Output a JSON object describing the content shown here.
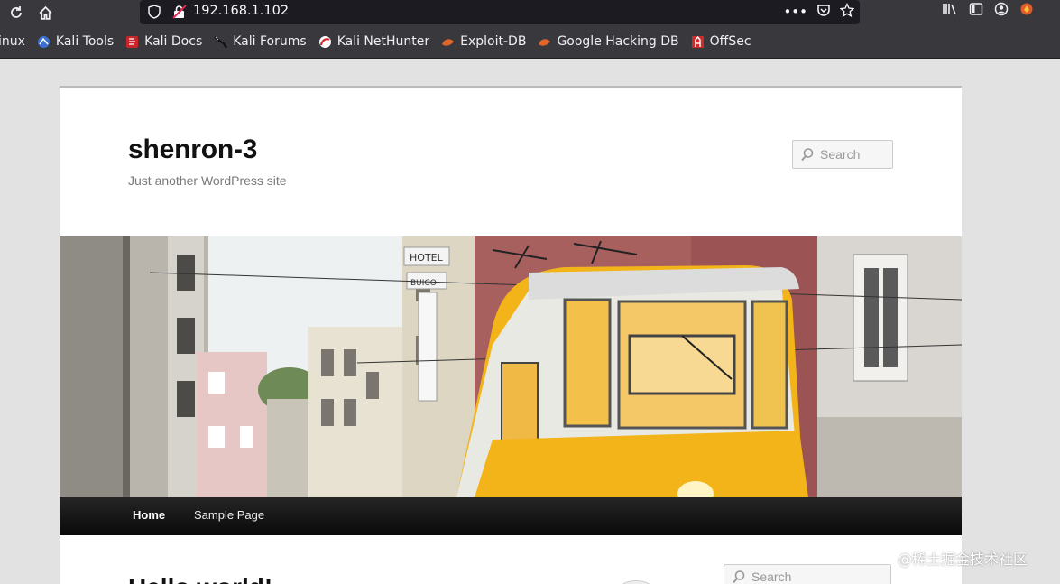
{
  "browser": {
    "url": "192.168.1.102",
    "bookmarks": [
      {
        "label": "inux",
        "icon": "none"
      },
      {
        "label": "Kali Tools",
        "icon": "kali-tools-icon"
      },
      {
        "label": "Kali Docs",
        "icon": "kali-docs-icon"
      },
      {
        "label": "Kali Forums",
        "icon": "kali-forums-icon"
      },
      {
        "label": "Kali NetHunter",
        "icon": "kali-nethunter-icon"
      },
      {
        "label": "Exploit-DB",
        "icon": "exploit-db-icon"
      },
      {
        "label": "Google Hacking DB",
        "icon": "ghdb-icon"
      },
      {
        "label": "OffSec",
        "icon": "offsec-icon"
      }
    ]
  },
  "site": {
    "title": "shenron-3",
    "description": "Just another WordPress site",
    "search_placeholder": "Search"
  },
  "nav": {
    "items": [
      {
        "label": "Home"
      },
      {
        "label": "Sample Page"
      }
    ]
  },
  "sidebar": {
    "search_placeholder": "Search"
  },
  "post": {
    "title_partial": "Hello world!"
  },
  "watermark": "@稀土掘金技术社区",
  "colors": {
    "toolbar": "#38383d",
    "urlbar": "#1c1b22",
    "nav_bar": "#111111",
    "page_bg": "#e2e2e2",
    "tram_yellow": "#f2b418"
  }
}
